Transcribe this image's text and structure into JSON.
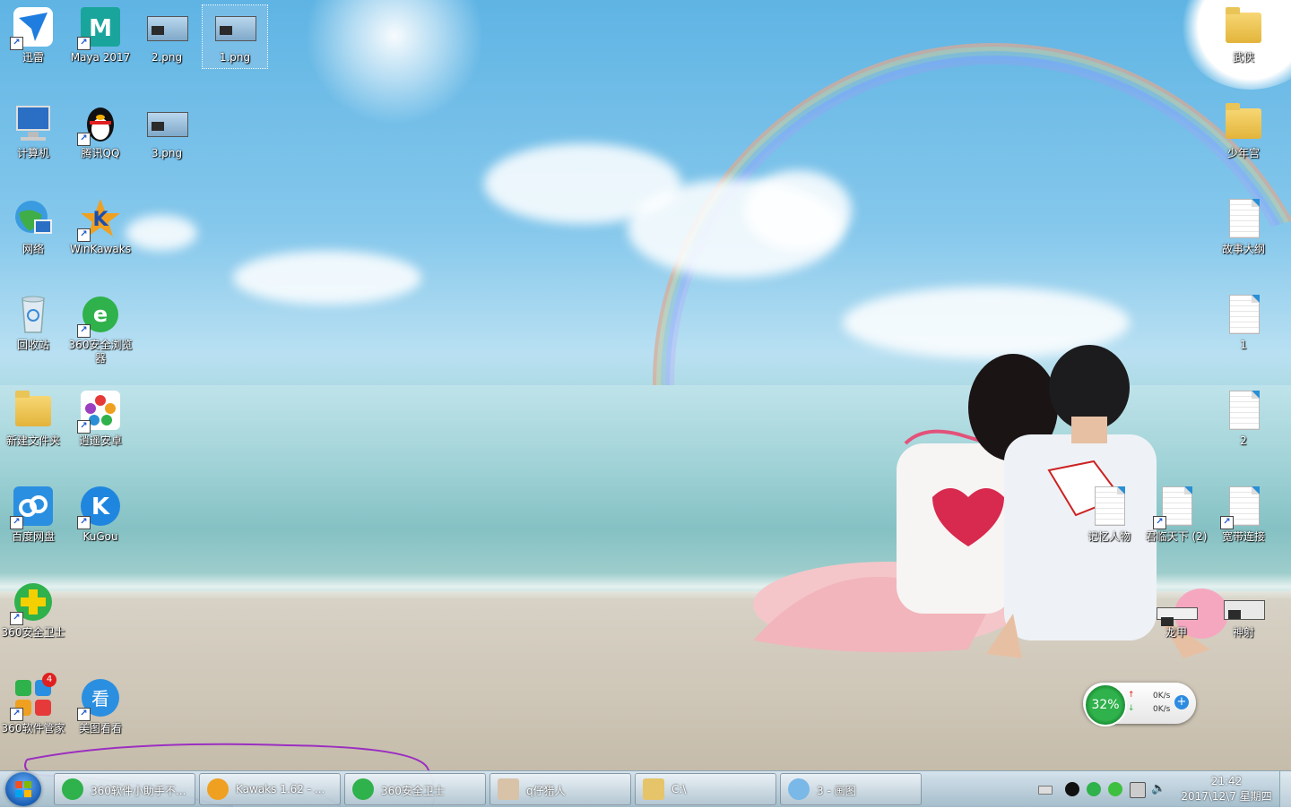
{
  "desktop": {
    "icons_left": [
      {
        "label": "迅雷"
      },
      {
        "label": "Maya 2017"
      },
      {
        "label": "2.png"
      },
      {
        "label": "1.png"
      },
      {
        "label": "计算机"
      },
      {
        "label": "腾讯QQ"
      },
      {
        "label": "3.png"
      },
      {
        "label": "网络"
      },
      {
        "label": "WinKawaks"
      },
      {
        "label": "回收站"
      },
      {
        "label": "360安全浏览器"
      },
      {
        "label": "新建文件夹"
      },
      {
        "label": "逍遥安卓"
      },
      {
        "label": "百度网盘"
      },
      {
        "label": "KuGou"
      },
      {
        "label": "360安全卫士"
      },
      {
        "label": "360软件管家"
      },
      {
        "label": "美图看看"
      }
    ],
    "icons_right": [
      {
        "label": "武侠"
      },
      {
        "label": "少年宫"
      },
      {
        "label": "故事大纲"
      },
      {
        "label": "1"
      },
      {
        "label": "2"
      },
      {
        "label": "记忆人物"
      },
      {
        "label": "君临天下 (2)"
      },
      {
        "label": "宽带连接"
      },
      {
        "label": "龙甲"
      },
      {
        "label": "神射"
      }
    ],
    "badge_360_manager": "4"
  },
  "net_widget": {
    "percent": "32%",
    "up_speed": "0K/s",
    "down_speed": "0K/s"
  },
  "taskbar": {
    "tasks": [
      {
        "label": "360软件小助手不..."
      },
      {
        "label": "Kawaks 1.62 - ..."
      },
      {
        "label": "360安全卫士"
      },
      {
        "label": "q仔猎人"
      },
      {
        "label": "C:\\"
      },
      {
        "label": "3 - 画图"
      }
    ],
    "clock_time": "21:42",
    "clock_date": "2017\\12\\7 星期四"
  },
  "colors": {
    "taskbar": "#a9bfcd",
    "widget_green": "#2fb14b",
    "scribble": "#9b2fc0"
  }
}
